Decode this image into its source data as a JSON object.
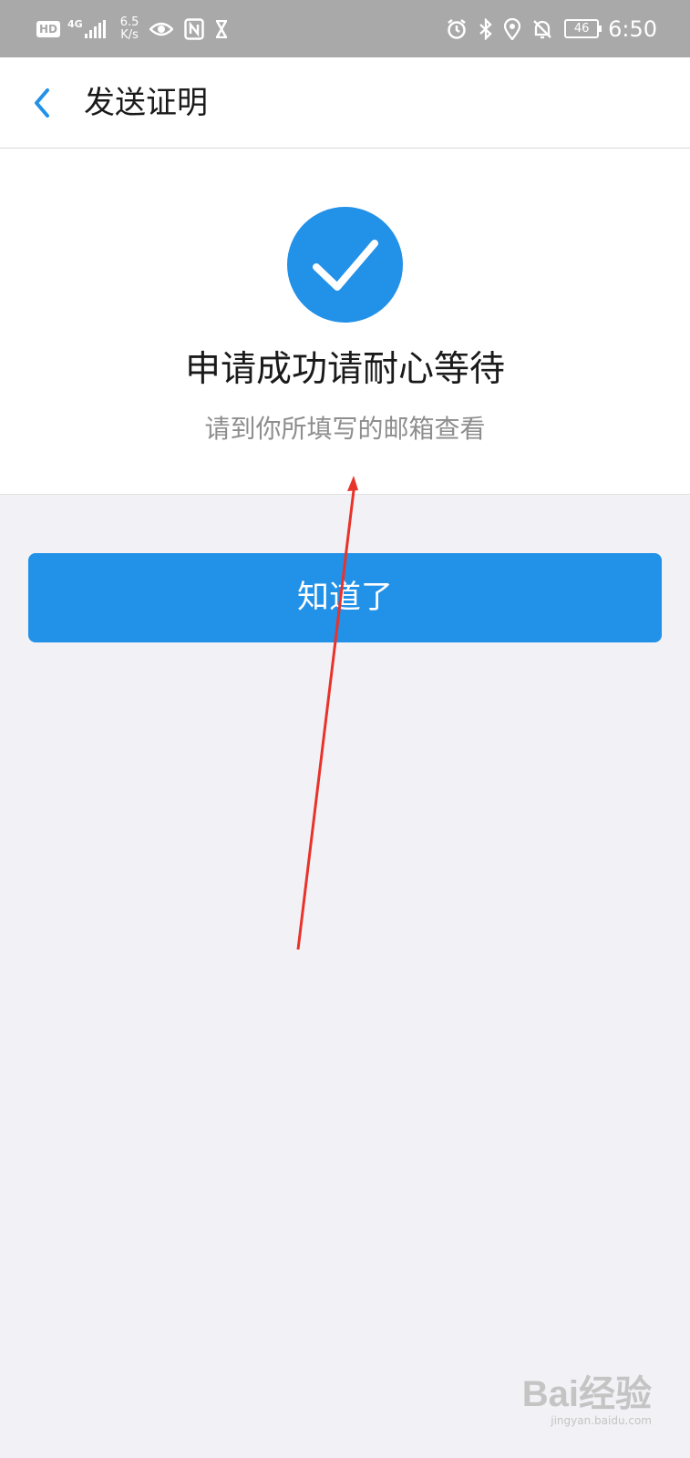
{
  "status_bar": {
    "hd_badge": "HD",
    "network_type": "4G",
    "net_speed_value": "6.5",
    "net_speed_unit": "K/s",
    "battery": "46",
    "time": "6:50",
    "icons": [
      "eye-icon",
      "nfc-icon",
      "hourglass-icon",
      "alarm-icon",
      "bluetooth-icon",
      "location-icon",
      "mute-bell-icon"
    ]
  },
  "nav": {
    "back_icon": "chevron-left-icon",
    "title": "发送证明"
  },
  "result": {
    "icon": "check-circle-icon",
    "title": "申请成功请耐心等待",
    "subtitle": "请到你所填写的邮箱查看"
  },
  "actions": {
    "confirm_label": "知道了"
  },
  "colors": {
    "accent": "#2291e8",
    "status_bar_bg": "#a9a9a9",
    "page_bg": "#f2f2f6",
    "annotation_arrow": "#e8332b"
  },
  "watermark": {
    "logo": "Bai经验",
    "url": "jingyan.baidu.com"
  }
}
